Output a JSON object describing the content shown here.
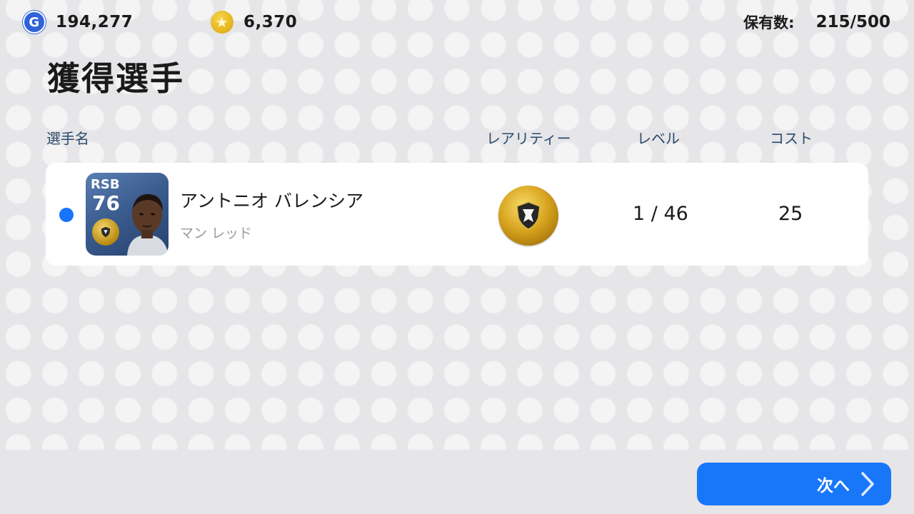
{
  "header": {
    "gp": {
      "icon": "gp-coin-icon",
      "icon_letter": "G",
      "value": "194,277"
    },
    "coins": {
      "icon": "star-coin-icon",
      "icon_glyph": "★",
      "value": "6,370"
    },
    "owned": {
      "label": "保有数:",
      "value": "215/500"
    }
  },
  "title": "獲得選手",
  "columns": {
    "name": "選手名",
    "rarity": "レアリティー",
    "level": "レベル",
    "cost": "コスト"
  },
  "players": [
    {
      "new_indicator_color": "#1774ff",
      "position": "RSB",
      "rating": "76",
      "name": "アントニオ バレンシア",
      "club": "マン レッド",
      "rarity_icon": "gold-rarity-badge-icon",
      "level": "1 / 46",
      "cost": "25"
    }
  ],
  "footer": {
    "next_label": "次へ",
    "next_icon": "chevron-right-icon"
  },
  "colors": {
    "accent": "#1877f8",
    "background": "#e6e6e9",
    "header_text": "#2a4a6b"
  }
}
